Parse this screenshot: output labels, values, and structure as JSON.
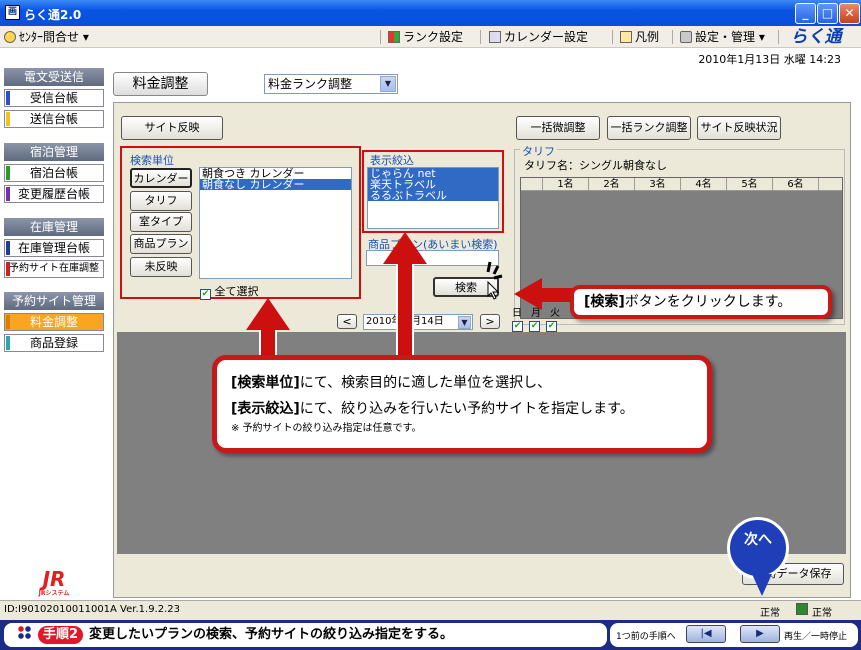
{
  "window": {
    "title": "らく通2.0",
    "min": "_",
    "max": "□",
    "close": "✕"
  },
  "menu": {
    "left": "ｾﾝﾀｰ問合せ ▾",
    "items": [
      "ランク設定",
      "カレンダー設定",
      "凡例",
      "設定・管理 ▾"
    ],
    "logo": "らく通"
  },
  "date": "2010年1月13日 水曜 14:23",
  "sidebar": {
    "sections": [
      {
        "title": "電文受送信",
        "items": [
          "受信台帳",
          "送信台帳"
        ]
      },
      {
        "title": "宿泊管理",
        "items": [
          "宿泊台帳",
          "変更履歴台帳"
        ]
      },
      {
        "title": "在庫管理",
        "items": [
          "在庫管理台帳",
          "予約サイト在庫調整"
        ]
      },
      {
        "title": "予約サイト管理",
        "items": [
          "料金調整",
          "商品登録"
        ]
      }
    ],
    "jr_logo": "JR",
    "jr_sub": "JRシステム"
  },
  "tab_title": "料金調整",
  "rank_select": "料金ランク調整",
  "buttons": {
    "site_reflect": "サイト反映",
    "bulk_adjust": "一括微調整",
    "bulk_rank": "一括ランク調整",
    "site_status": "サイト反映状況",
    "search": "検索",
    "save": "臨時データ保存"
  },
  "search_unit": {
    "label": "検索単位",
    "buttons": [
      "カレンダー",
      "タリフ",
      "室タイプ",
      "商品プラン",
      "未反映"
    ],
    "list": [
      "朝食つき カレンダー",
      "朝食なし カレンダー"
    ],
    "select_all": "全て選択"
  },
  "display_filter": {
    "label": "表示絞込",
    "list": [
      "じゃらん net",
      "楽天トラベル",
      "るるぶトラベル"
    ]
  },
  "plan_search": {
    "label": "商品プラン(あいまい検索)",
    "value": ""
  },
  "tariff": {
    "label": "タリフ",
    "name": "タリフ名：シングル朝食なし",
    "columns": [
      "",
      "1名",
      "2名",
      "3名",
      "4名",
      "5名",
      "6名"
    ]
  },
  "date_nav": {
    "prev": "<",
    "next": ">",
    "date": "2010年 1月14日"
  },
  "weekdays": [
    "日",
    "月",
    "火"
  ],
  "callout_main": {
    "line1_bold": "[検索単位]",
    "line1_rest": "にて、検索目的に適した単位を選択し、",
    "line2_bold": "[表示絞込]",
    "line2_rest": "にて、絞り込みを行いたい予約サイトを指定します。",
    "note": "※ 予約サイトの絞り込み指定は任意です。"
  },
  "callout_search": {
    "bold": "[検索]",
    "rest": "ボタンをクリックします。"
  },
  "next_badge": "次へ",
  "status": {
    "id": "ID:I90102010011001A  Ver.1.9.2.23",
    "s1": "正常",
    "s2": "正常"
  },
  "bottom": {
    "step": "手順2",
    "text": "変更したいプランの検索、予約サイトの絞り込み指定をする。",
    "prev_label": "1つ前の手順へ",
    "play_label": "再生／一時停止",
    "prev_btn": "|◀",
    "play_btn": "▶"
  },
  "colors": {
    "accent_red": "#cc1010",
    "sidebar_active": "#f9a51f",
    "title_blue": "#0a54e4",
    "bottom_bar": "#1c2c86"
  }
}
